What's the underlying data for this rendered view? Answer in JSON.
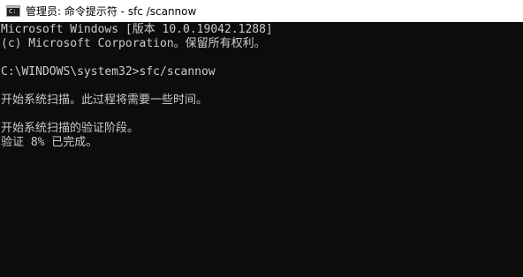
{
  "window": {
    "title": "管理员: 命令提示符 - sfc /scannow",
    "icon": "cmd-icon"
  },
  "console": {
    "lines": [
      "Microsoft Windows [版本 10.0.19042.1288]",
      "(c) Microsoft Corporation。保留所有权利。",
      "",
      "C:\\WINDOWS\\system32>sfc/scannow",
      "",
      "开始系统扫描。此过程将需要一些时间。",
      "",
      "开始系统扫描的验证阶段。",
      "验证 8% 已完成。"
    ]
  }
}
